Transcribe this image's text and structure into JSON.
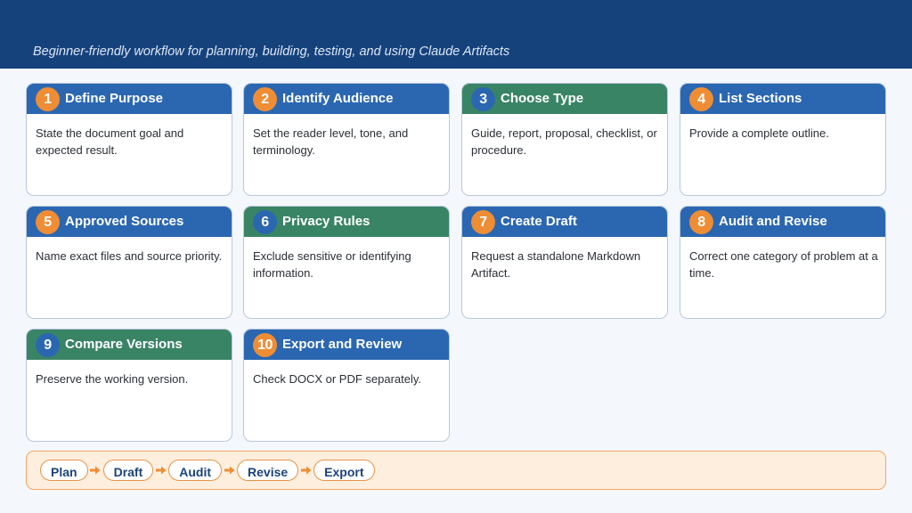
{
  "header": {
    "subtitle": "Beginner-friendly workflow for planning, building, testing, and using Claude Artifacts"
  },
  "colors": {
    "header_bg": "#16427c",
    "card_head_blue": "#2b67b1",
    "card_head_green": "#3a8466",
    "badge_orange": "#ef8d35",
    "flow_bg": "#fdeedd",
    "flow_border": "#eea867"
  },
  "steps": [
    {
      "number": "1",
      "title": "Define Purpose",
      "description": "State the document goal and expected result.",
      "head_color": "blue",
      "badge_color": "orange"
    },
    {
      "number": "2",
      "title": "Identify Audience",
      "description": "Set the reader level, tone, and terminology.",
      "head_color": "blue",
      "badge_color": "orange"
    },
    {
      "number": "3",
      "title": "Choose Type",
      "description": "Guide, report, proposal, checklist, or procedure.",
      "head_color": "green",
      "badge_color": "navy"
    },
    {
      "number": "4",
      "title": "List Sections",
      "description": "Provide a complete outline.",
      "head_color": "blue",
      "badge_color": "orange"
    },
    {
      "number": "5",
      "title": "Approved Sources",
      "description": "Name exact files and source priority.",
      "head_color": "blue",
      "badge_color": "orange"
    },
    {
      "number": "6",
      "title": "Privacy Rules",
      "description": "Exclude sensitive or identifying information.",
      "head_color": "green",
      "badge_color": "navy"
    },
    {
      "number": "7",
      "title": "Create Draft",
      "description": "Request a standalone Markdown Artifact.",
      "head_color": "blue",
      "badge_color": "orange"
    },
    {
      "number": "8",
      "title": "Audit and Revise",
      "description": "Correct one category of problem at a time.",
      "head_color": "blue",
      "badge_color": "orange"
    },
    {
      "number": "9",
      "title": "Compare Versions",
      "description": "Preserve the working version.",
      "head_color": "green",
      "badge_color": "navy"
    },
    {
      "number": "10",
      "title": "Export and Review",
      "description": "Check DOCX or PDF separately.",
      "head_color": "blue",
      "badge_color": "orange"
    }
  ],
  "flow": {
    "stages": [
      "Plan",
      "Draft",
      "Audit",
      "Revise",
      "Export"
    ]
  }
}
